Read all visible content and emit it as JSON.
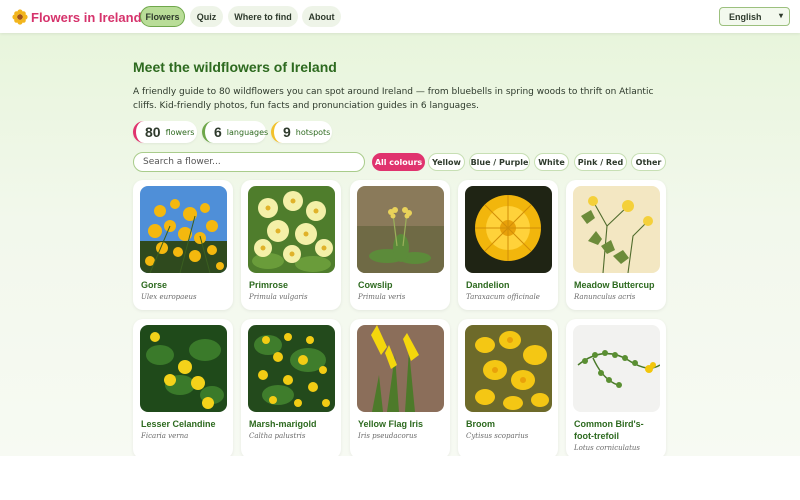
{
  "header": {
    "site_title": "Flowers in Ireland",
    "nav": [
      {
        "label": "Flowers",
        "active": true
      },
      {
        "label": "Quiz",
        "active": false
      },
      {
        "label": "Where to find",
        "active": false
      },
      {
        "label": "About",
        "active": false
      }
    ],
    "language": "English"
  },
  "main": {
    "title": "Meet the wildflowers of Ireland",
    "intro": "A friendly guide to 80 wildflowers you can spot around Ireland — from bluebells in spring woods to thrift on Atlantic cliffs. Kid-friendly photos, fun facts and pronunciation guides in 6 languages.",
    "stats": [
      {
        "value": "80",
        "label": "flowers",
        "accent": "#e0336e"
      },
      {
        "value": "6",
        "label": "languages",
        "accent": "#6fa74b"
      },
      {
        "value": "9",
        "label": "hotspots",
        "accent": "#f2c12e"
      }
    ],
    "search_placeholder": "Search a flower...",
    "filters": [
      {
        "label": "All colours",
        "active": true
      },
      {
        "label": "Yellow",
        "active": false
      },
      {
        "label": "Blue / Purple",
        "active": false
      },
      {
        "label": "White",
        "active": false
      },
      {
        "label": "Pink / Red",
        "active": false
      },
      {
        "label": "Other",
        "active": false
      }
    ],
    "flowers": [
      {
        "name": "Gorse",
        "latin": "Ulex europaeus"
      },
      {
        "name": "Primrose",
        "latin": "Primula vulgaris"
      },
      {
        "name": "Cowslip",
        "latin": "Primula veris"
      },
      {
        "name": "Dandelion",
        "latin": "Taraxacum officinale"
      },
      {
        "name": "Meadow Buttercup",
        "latin": "Ranunculus acris"
      },
      {
        "name": "Lesser Celandine",
        "latin": "Ficaria verna"
      },
      {
        "name": "Marsh-marigold",
        "latin": "Caltha palustris"
      },
      {
        "name": "Yellow Flag Iris",
        "latin": "Iris pseudacorus"
      },
      {
        "name": "Broom",
        "latin": "Cytisus scoparius"
      },
      {
        "name": "Common Bird's-foot-trefoil",
        "latin": "Lotus corniculatus"
      }
    ]
  },
  "colors": {
    "brand_pink": "#d6336c",
    "accent_green": "#2d6a1f",
    "active_filter": "#e0336e",
    "nav_active": "#b9dd98"
  },
  "icons": [
    "flower-logo-icon",
    "chevron-down-icon"
  ]
}
